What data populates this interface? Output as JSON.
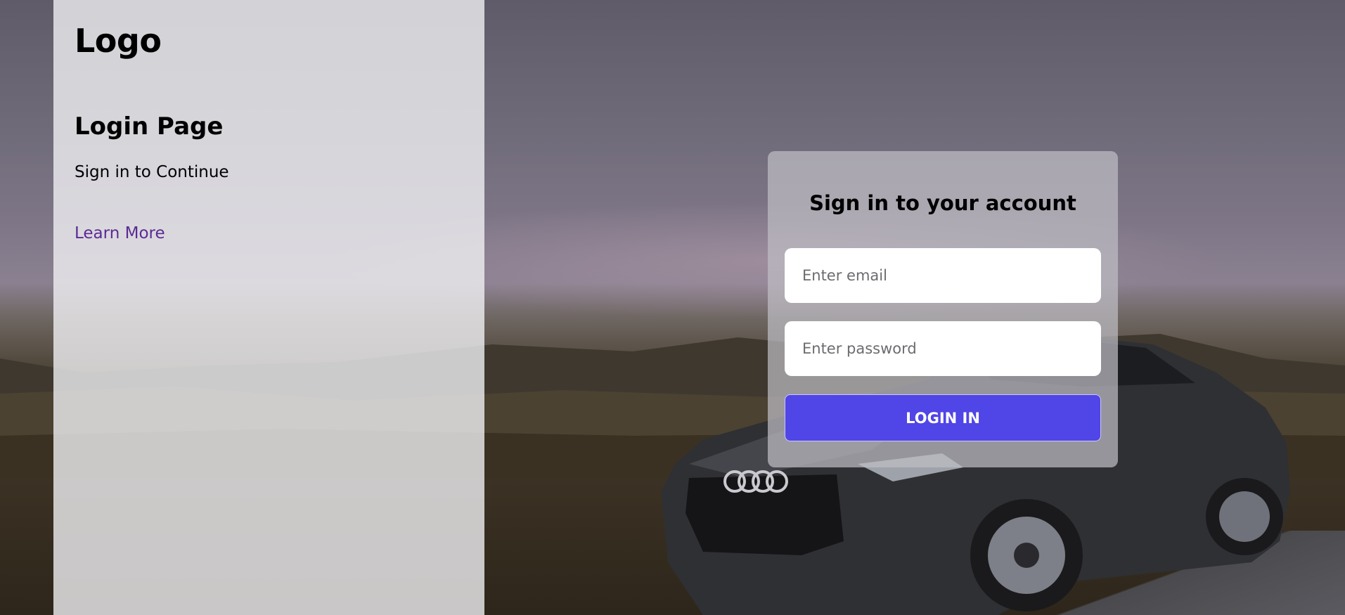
{
  "sidebar": {
    "logo": "Logo",
    "title": "Login Page",
    "subtitle": "Sign in to Continue",
    "learn_more_label": "Learn More"
  },
  "login_card": {
    "title": "Sign in to your account",
    "email_placeholder": "Enter email",
    "email_value": "",
    "password_placeholder": "Enter password",
    "password_value": "",
    "submit_label": "LOGIN IN"
  },
  "colors": {
    "accent": "#5045e6",
    "link": "#5b2a95"
  }
}
